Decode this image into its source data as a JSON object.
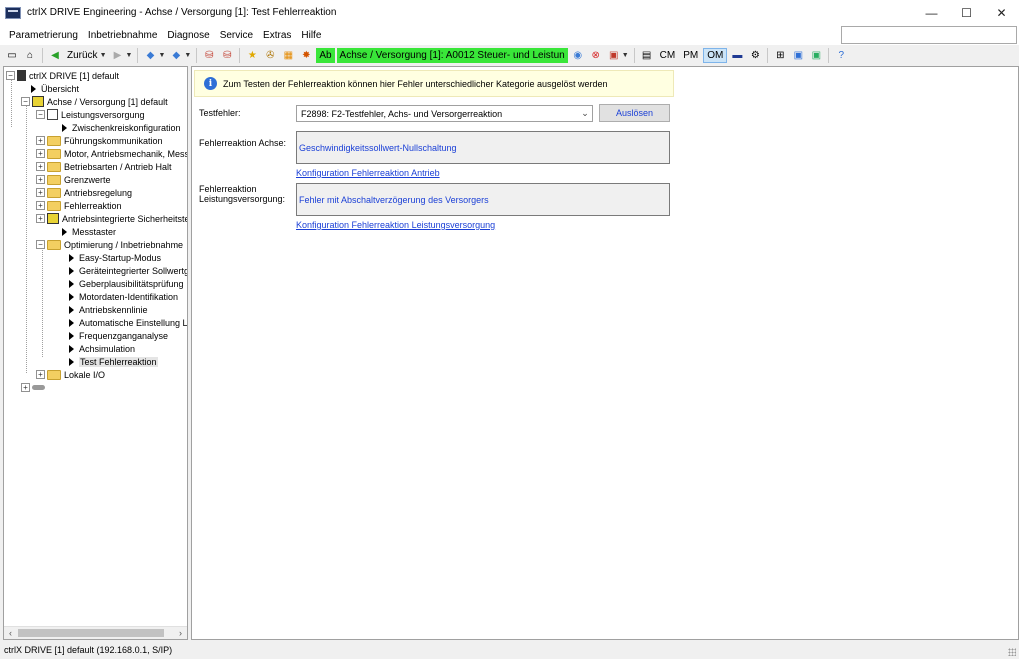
{
  "window": {
    "title": "ctrlX DRIVE Engineering - Achse / Versorgung [1]: Test Fehlerreaktion",
    "minimize": "—",
    "maximize": "☐",
    "close": "✕"
  },
  "menu": [
    "Parametrierung",
    "Inbetriebnahme",
    "Diagnose",
    "Service",
    "Extras",
    "Hilfe"
  ],
  "toolbar": {
    "back_label": "Zurück",
    "ab_label": "Ab",
    "device_label": "Achse / Versorgung [1]:  A0012 Steuer- und Leistun",
    "modes": [
      "CM",
      "PM",
      "OM"
    ],
    "active_mode": "OM"
  },
  "tree": {
    "items": [
      {
        "label": "ctrlX DRIVE [1] default"
      },
      {
        "label": "Übersicht"
      },
      {
        "label": "Achse / Versorgung [1] default"
      },
      {
        "label": "Leistungsversorgung"
      },
      {
        "label": "Zwischenkreiskonfiguration"
      },
      {
        "label": "Führungskommunikation"
      },
      {
        "label": "Motor, Antriebsmechanik, Messs"
      },
      {
        "label": "Betriebsarten / Antrieb Halt"
      },
      {
        "label": "Grenzwerte"
      },
      {
        "label": "Antriebsregelung"
      },
      {
        "label": "Fehlerreaktion"
      },
      {
        "label": "Antriebsintegrierte Sicherheitste"
      },
      {
        "label": "Messtaster"
      },
      {
        "label": "Optimierung / Inbetriebnahme"
      },
      {
        "label": "Easy-Startup-Modus"
      },
      {
        "label": "Geräteintegrierter Sollwertge"
      },
      {
        "label": "Geberplausibilitätsprüfung"
      },
      {
        "label": "Motordaten-Identifikation"
      },
      {
        "label": "Antriebskennlinie"
      },
      {
        "label": "Automatische Einstellung La"
      },
      {
        "label": "Frequenzganganalyse"
      },
      {
        "label": "Achsimulation"
      },
      {
        "label": "Test Fehlerreaktion"
      },
      {
        "label": "Lokale I/O"
      }
    ]
  },
  "content": {
    "info_text": "Zum Testen der Fehlerreaktion können hier Fehler unterschiedlicher Kategorie ausgelöst werden",
    "testfehler_label": "Testfehler:",
    "testfehler_value": "F2898: F2-Testfehler, Achs- und Versorgerreaktion",
    "trigger_button": "Auslösen",
    "achse_label": "Fehlerreaktion Achse:",
    "achse_value": "Geschwindigkeitssollwert-Nullschaltung",
    "achse_link": "Konfiguration Fehlerreaktion Antrieb",
    "versorgung_label_1": "Fehlerreaktion",
    "versorgung_label_2": "Leistungsversorgung:",
    "versorgung_value": "Fehler mit Abschaltverzögerung des Versorgers",
    "versorgung_link": "Konfiguration Fehlerreaktion Leistungsversorgung"
  },
  "status": {
    "text": "ctrlX DRIVE [1] default (192.168.0.1, S/IP)"
  },
  "colors": {
    "active_device_bg": "#39e639",
    "link": "#1a3fd6",
    "info_bg": "#ffffe1"
  }
}
